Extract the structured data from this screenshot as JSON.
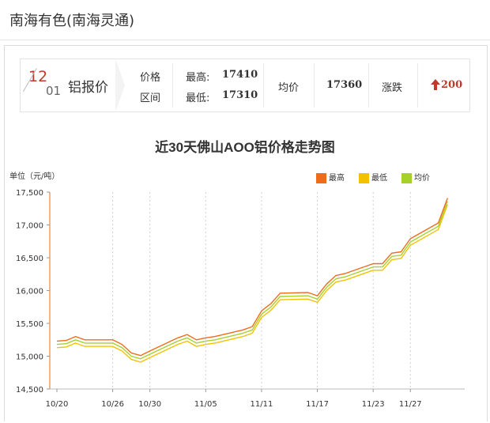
{
  "page": {
    "title": "南海有色(南海灵通)"
  },
  "quote": {
    "date_month": "12",
    "date_day": "01",
    "name": "铝报价",
    "range_label_1": "价格",
    "range_label_2": "区间",
    "high_label": "最高:",
    "high_value": "17410",
    "low_label": "最低:",
    "low_value": "17310",
    "avg_label": "均价",
    "avg_value": "17360",
    "change_label": "涨跌",
    "change_value": "200",
    "change_color": "#c0392b"
  },
  "chart_data": {
    "type": "line",
    "title": "近30天佛山AOO铝价格走势图",
    "ylabel": "单位（元/吨）",
    "xlabel": "",
    "ylim": [
      14500,
      17500
    ],
    "yticks": [
      "14,500",
      "15,000",
      "15,500",
      "16,000",
      "16,500",
      "17,000",
      "17,500"
    ],
    "ytick_values": [
      14500,
      15000,
      15500,
      16000,
      16500,
      17000,
      17500
    ],
    "x": [
      "10/20",
      "10/21",
      "10/22",
      "10/23",
      "10/24",
      "10/25",
      "10/26",
      "10/27",
      "10/28",
      "10/29",
      "10/30",
      "10/31",
      "11/01",
      "11/02",
      "11/03",
      "11/04",
      "11/05",
      "11/06",
      "11/07",
      "11/08",
      "11/09",
      "11/10",
      "11/11",
      "11/12",
      "11/13",
      "11/14",
      "11/15",
      "11/16",
      "11/17",
      "11/18",
      "11/19",
      "11/20",
      "11/21",
      "11/22",
      "11/23",
      "11/24",
      "11/25",
      "11/26",
      "11/27",
      "11/28",
      "11/29",
      "11/30",
      "12/01"
    ],
    "xtick_labels": [
      "10/20",
      "10/26",
      "10/30",
      "11/05",
      "11/11",
      "11/17",
      "11/23",
      "11/27"
    ],
    "xtick_values": [
      "10/20",
      "10/26",
      "10/30",
      "11/05",
      "11/11",
      "11/17",
      "11/23",
      "11/27"
    ],
    "trading_days": [
      "10/20",
      "10/21",
      "10/22",
      "10/23",
      "10/26",
      "10/27",
      "10/28",
      "10/29",
      "10/30",
      "11/02",
      "11/03",
      "11/04",
      "11/05",
      "11/06",
      "11/09",
      "11/10",
      "11/11",
      "11/12",
      "11/13",
      "11/16",
      "11/17",
      "11/18",
      "11/19",
      "11/20",
      "11/23",
      "11/24",
      "11/25",
      "11/26",
      "11/27",
      "11/30",
      "12/01"
    ],
    "legend_position": "top-right",
    "grid": "vertical-dashed",
    "series": [
      {
        "name": "最高",
        "color": "#ef6c1a",
        "values": [
          15230,
          15240,
          15300,
          15250,
          15250,
          15180,
          15050,
          15010,
          15080,
          15280,
          15330,
          15250,
          15280,
          15300,
          15400,
          15450,
          15690,
          15800,
          15960,
          15970,
          15920,
          16100,
          16230,
          16260,
          16410,
          16410,
          16570,
          16590,
          16790,
          17030,
          17410
        ]
      },
      {
        "name": "最低",
        "color": "#f2c200",
        "values": [
          15130,
          15140,
          15200,
          15150,
          15150,
          15080,
          14950,
          14910,
          14980,
          15180,
          15230,
          15150,
          15180,
          15200,
          15300,
          15350,
          15590,
          15700,
          15860,
          15870,
          15820,
          16000,
          16130,
          16160,
          16310,
          16310,
          16470,
          16490,
          16690,
          16930,
          17310
        ]
      },
      {
        "name": "均价",
        "color": "#a6d12b",
        "values": [
          15180,
          15190,
          15250,
          15200,
          15200,
          15130,
          15000,
          14960,
          15030,
          15230,
          15280,
          15200,
          15230,
          15250,
          15350,
          15400,
          15640,
          15750,
          15910,
          15920,
          15870,
          16050,
          16180,
          16210,
          16360,
          16360,
          16520,
          16540,
          16740,
          16980,
          17360
        ]
      }
    ]
  }
}
